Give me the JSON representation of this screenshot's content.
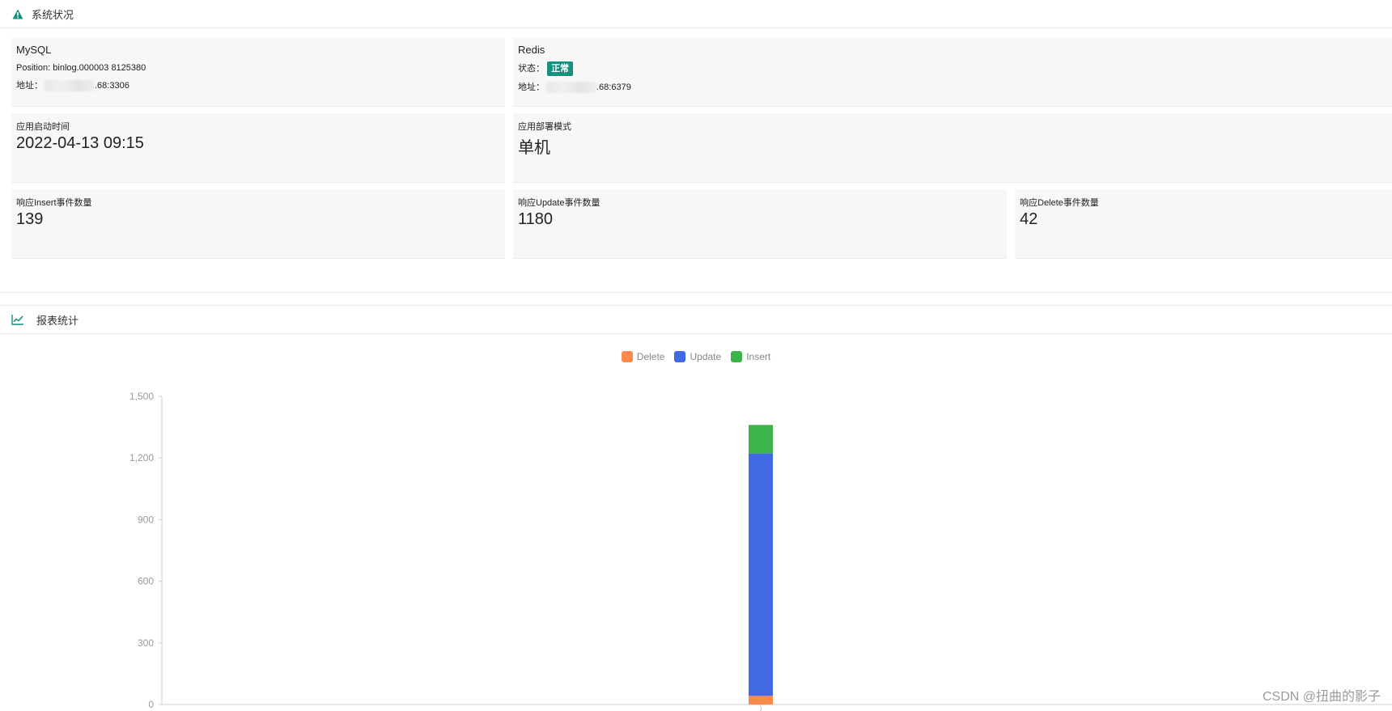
{
  "system_panel": {
    "title": "系统状况",
    "icon": "warning-icon",
    "accent": "#16907f"
  },
  "mysql": {
    "title": "MySQL",
    "position_label": "Position:",
    "position_value": "binlog.000003 8125380",
    "address_label": "地址：",
    "address_value": ".68:3306"
  },
  "redis": {
    "title": "Redis",
    "status_label": "状态：",
    "status_value": "正常",
    "address_label": "地址：",
    "address_value": ".68:6379"
  },
  "app_start": {
    "label": "应用启动时间",
    "value": "2022-04-13 09:15"
  },
  "deploy_mode": {
    "label": "应用部署模式",
    "value": "单机"
  },
  "insert_count": {
    "label": "响应Insert事件数量",
    "value": "139"
  },
  "update_count": {
    "label": "响应Update事件数量",
    "value": "1180"
  },
  "delete_count": {
    "label": "响应Delete事件数量",
    "value": "42"
  },
  "report_panel": {
    "title": "报表统计",
    "icon": "line-chart-icon"
  },
  "chart_data": {
    "type": "bar",
    "stacked": true,
    "categories": [
      "/"
    ],
    "series": [
      {
        "name": "Delete",
        "color": "#fd8a4b",
        "values": [
          42
        ]
      },
      {
        "name": "Update",
        "color": "#4169e1",
        "values": [
          1180
        ]
      },
      {
        "name": "Insert",
        "color": "#3cb449",
        "values": [
          139
        ]
      }
    ],
    "yticks": [
      "0",
      "300",
      "600",
      "900",
      "1,200",
      "1,500"
    ],
    "ylim": [
      0,
      1500
    ],
    "legend_position": "top-center",
    "grid": false
  },
  "watermark": "CSDN @扭曲的影子"
}
